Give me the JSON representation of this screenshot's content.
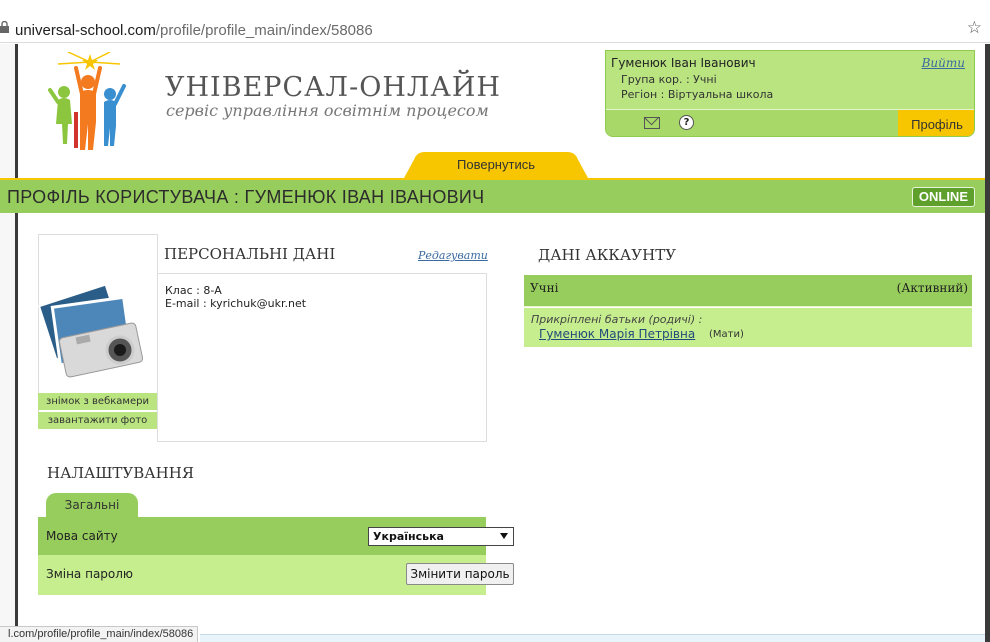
{
  "browser": {
    "url_host": "universal-school.com",
    "url_path": "/profile/profile_main/index/58086",
    "star": "☆"
  },
  "header": {
    "logo_title": "УНІВЕРСАЛ-ОНЛАЙН",
    "logo_subtitle": "сервіс управління освітнім процесом"
  },
  "user_panel": {
    "user_name": "Гуменюк Іван Іванович",
    "logout": "Вийти",
    "group": "Група кор. : Учні",
    "region": "Регіон : Віртуальна школа",
    "help_glyph": "?",
    "profile_button": "Профіль"
  },
  "nav": {
    "back_tab": "Повернутись"
  },
  "title_bar": {
    "title": "ПРОФІЛЬ КОРИСТУВАЧА : ГУМЕНЮК ІВАН ІВАНОВИЧ",
    "online_badge": "ONLINE"
  },
  "photo": {
    "webcam_link": "знімок з вебкамери",
    "upload_link": "завантажити фото"
  },
  "personal": {
    "heading": "ПЕРСОНАЛЬНІ ДАНІ",
    "edit": "Редагувати",
    "class_line": "Клас : 8-А",
    "email_line": "E-mail : kyrichuk@ukr.net"
  },
  "account": {
    "heading": "ДАНІ АККАУНТУ",
    "role": "Учні",
    "status": "(Активний)",
    "parents_label": "Прикріплені батьки (родичі) :",
    "parent_name": "Гуменюк Марія Петрівна",
    "parent_relation": "(Мати)"
  },
  "settings": {
    "heading": "НАЛАШТУВАННЯ",
    "tab_general": "Загальні",
    "language_label": "Мова сайту",
    "language_value": "Українська",
    "password_label": "Зміна паролю",
    "password_button": "Змінити пароль"
  },
  "status_bar": {
    "hover_url": "l.com/profile/profile_main/index/58086"
  },
  "colors": {
    "green": "#97cd5c",
    "light_green": "#b9e480",
    "yellow": "#f7c600",
    "online": "#5ea02b"
  }
}
